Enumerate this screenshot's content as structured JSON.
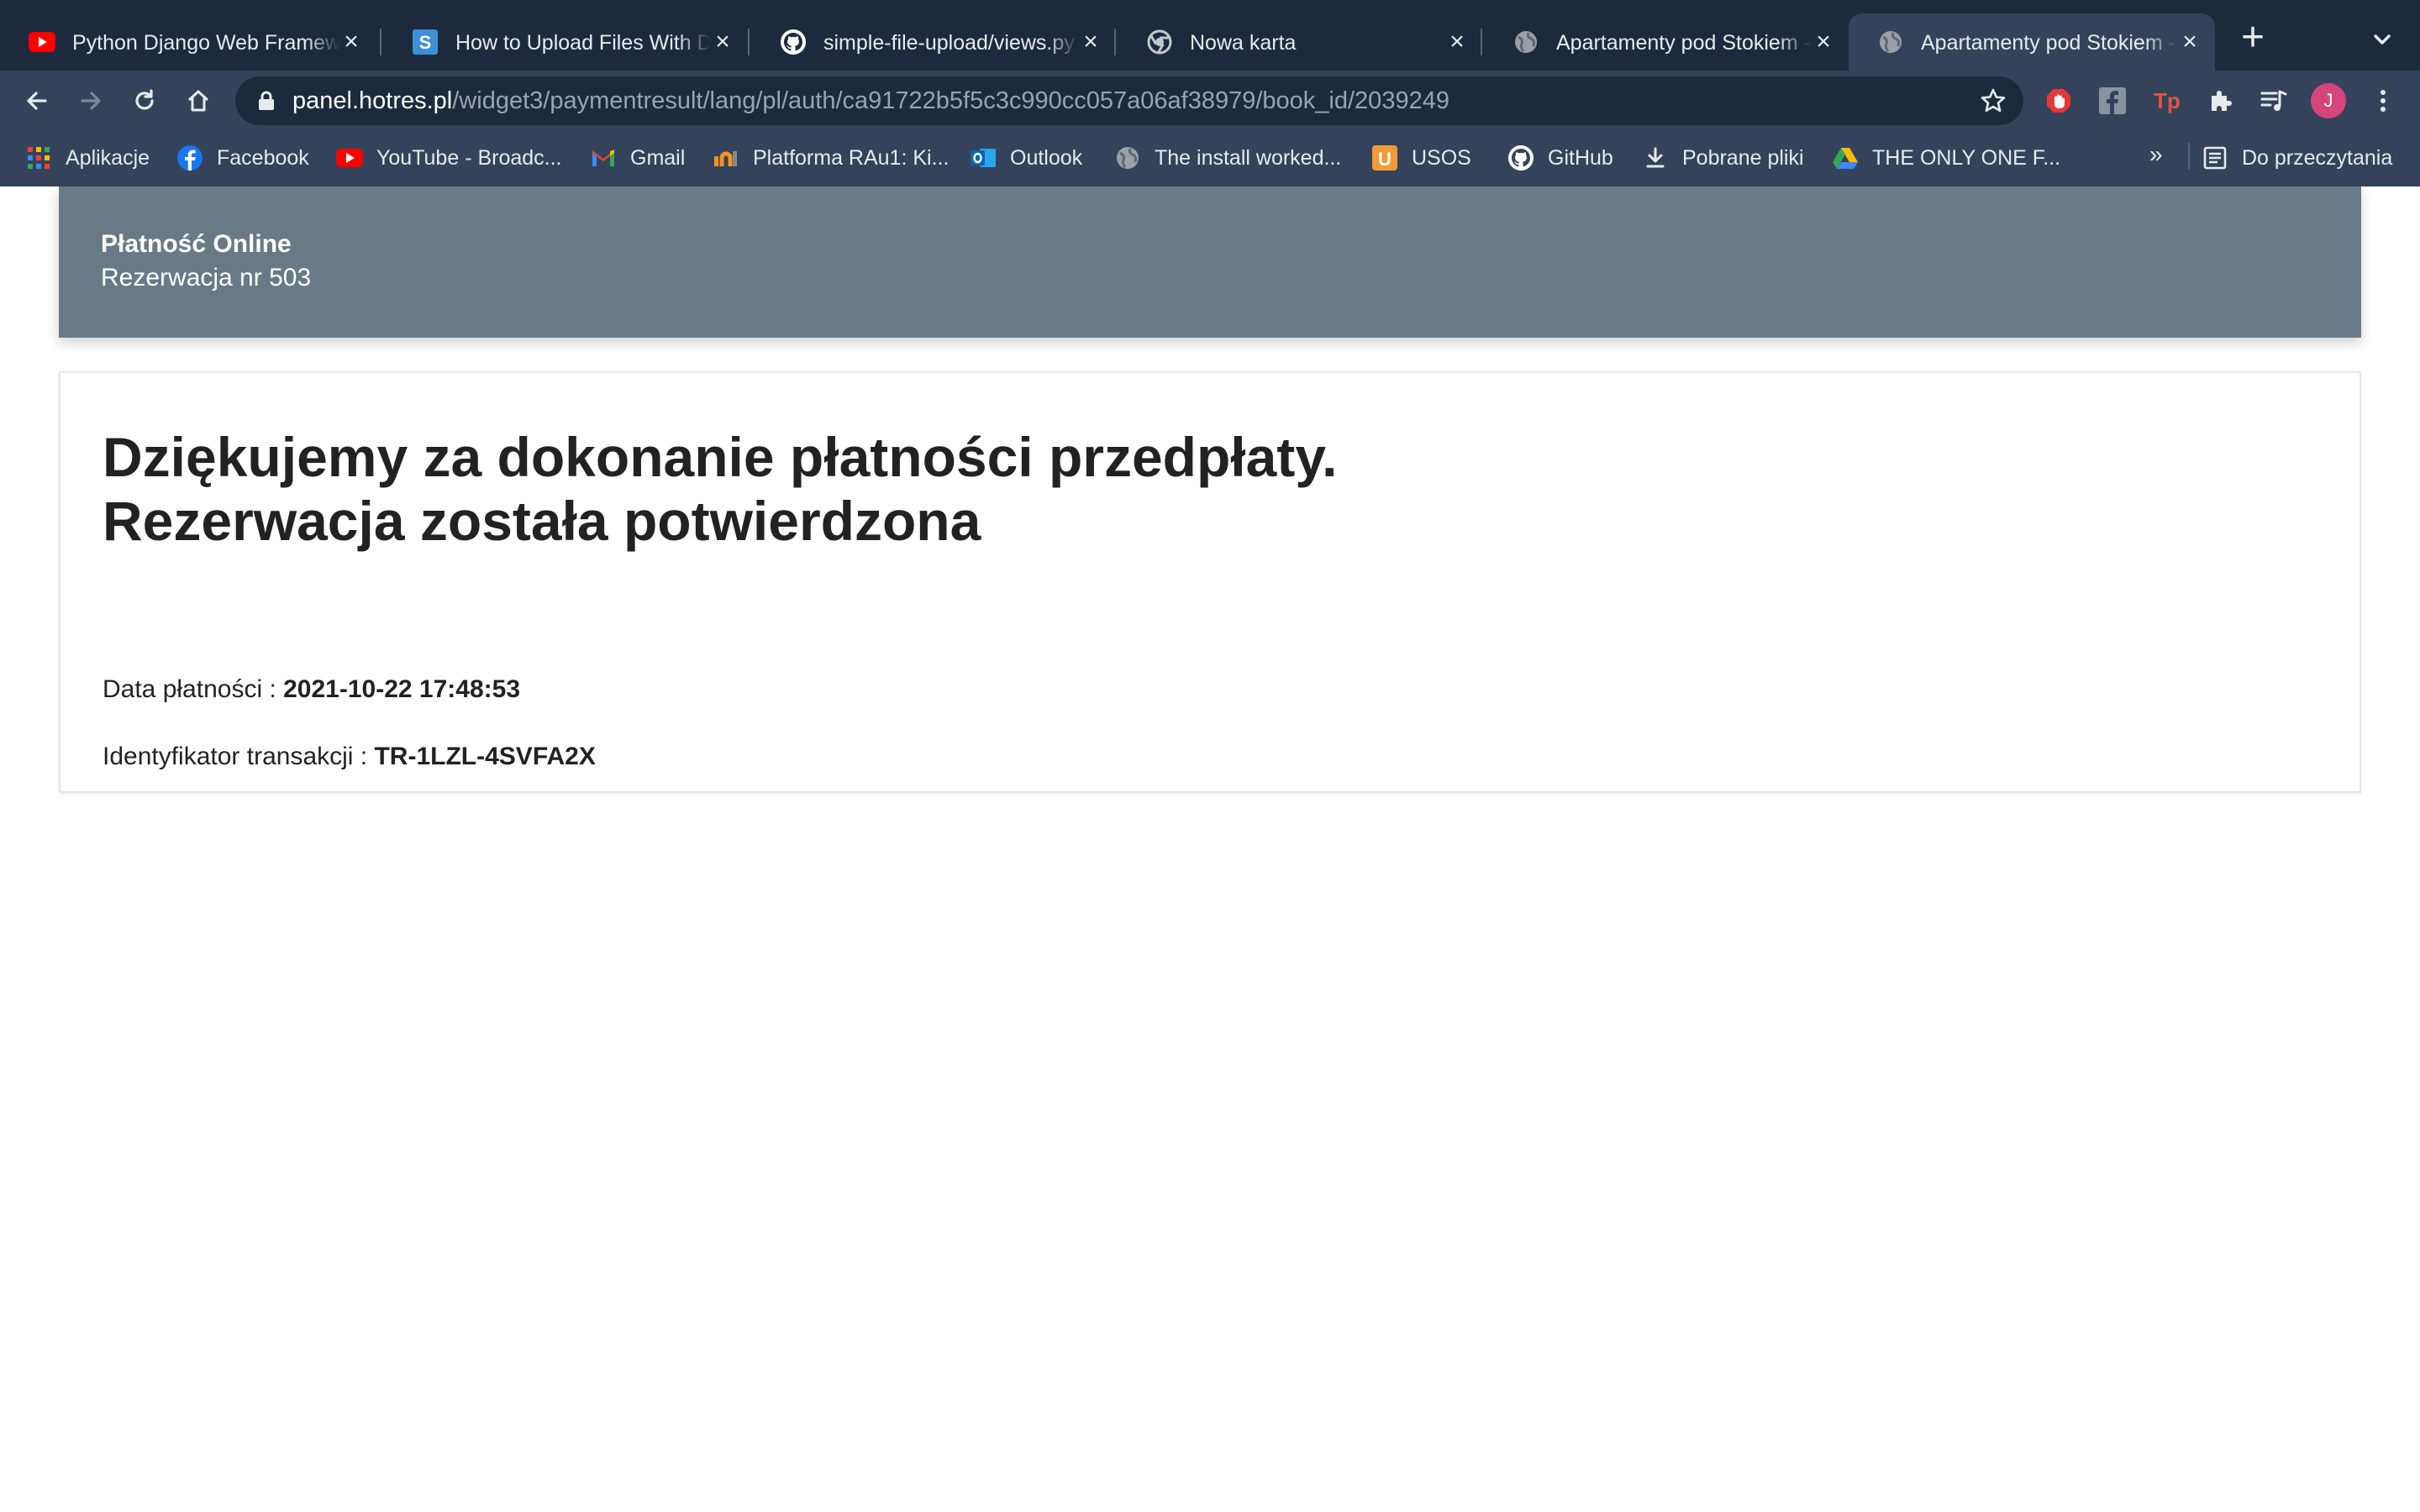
{
  "browser": {
    "tabs": [
      {
        "title": "Python Django Web Framework - Full Course for Beginners",
        "icon": "youtube-icon",
        "active": false
      },
      {
        "title": "How to Upload Files With Django",
        "icon": "s-site-icon",
        "active": false
      },
      {
        "title": "simple-file-upload/views.py",
        "icon": "github-icon",
        "active": false
      },
      {
        "title": "Nowa karta",
        "icon": "chrome-icon",
        "active": false
      },
      {
        "title": "Apartamenty pod Stokiem - Płatność",
        "icon": "globe-icon",
        "active": false
      },
      {
        "title": "Apartamenty pod Stokiem - Płatność",
        "icon": "globe-icon",
        "active": true
      }
    ],
    "url_host": "panel.hotres.pl",
    "url_path": "/widget3/paymentresult/lang/pl/auth/ca91722b5f5c3c990cc057a06af38979/book_id/2039249",
    "avatar_letter": "J",
    "bookmarks": [
      {
        "label": "Aplikacje",
        "icon": "apps-grid-icon"
      },
      {
        "label": "Facebook",
        "icon": "facebook-icon"
      },
      {
        "label": "YouTube - Broadc...",
        "icon": "youtube-icon"
      },
      {
        "label": "Gmail",
        "icon": "gmail-icon"
      },
      {
        "label": "Platforma RAu1: Ki...",
        "icon": "platforma-icon"
      },
      {
        "label": "Outlook",
        "icon": "outlook-icon"
      },
      {
        "label": "The install worked...",
        "icon": "globe-icon"
      },
      {
        "label": "USOS",
        "icon": "usos-icon"
      },
      {
        "label": "GitHub",
        "icon": "github-icon"
      },
      {
        "label": "Pobrane pliki",
        "icon": "download-icon"
      },
      {
        "label": "THE ONLY ONE F...",
        "icon": "drive-icon"
      }
    ],
    "overflow": "»",
    "reading_list": "Do przeczytania"
  },
  "header": {
    "title": "Płatność Online",
    "subtitle": "Rezerwacja nr 503"
  },
  "content": {
    "heading_line1": "Dziękujemy za dokonanie płatności przedpłaty.",
    "heading_line2": "Rezerwacja została potwierdzona",
    "payment_date_label": "Data płatności :",
    "payment_date_value": "2021-10-22 17:48:53",
    "transaction_id_label": "Identyfikator transakcji :",
    "transaction_id_value": "TR-1LZL-4SVFA2X"
  },
  "colors": {
    "tabstrip": "#1d2a3e",
    "toolbar": "#34435b",
    "header_bar": "#687a86"
  }
}
